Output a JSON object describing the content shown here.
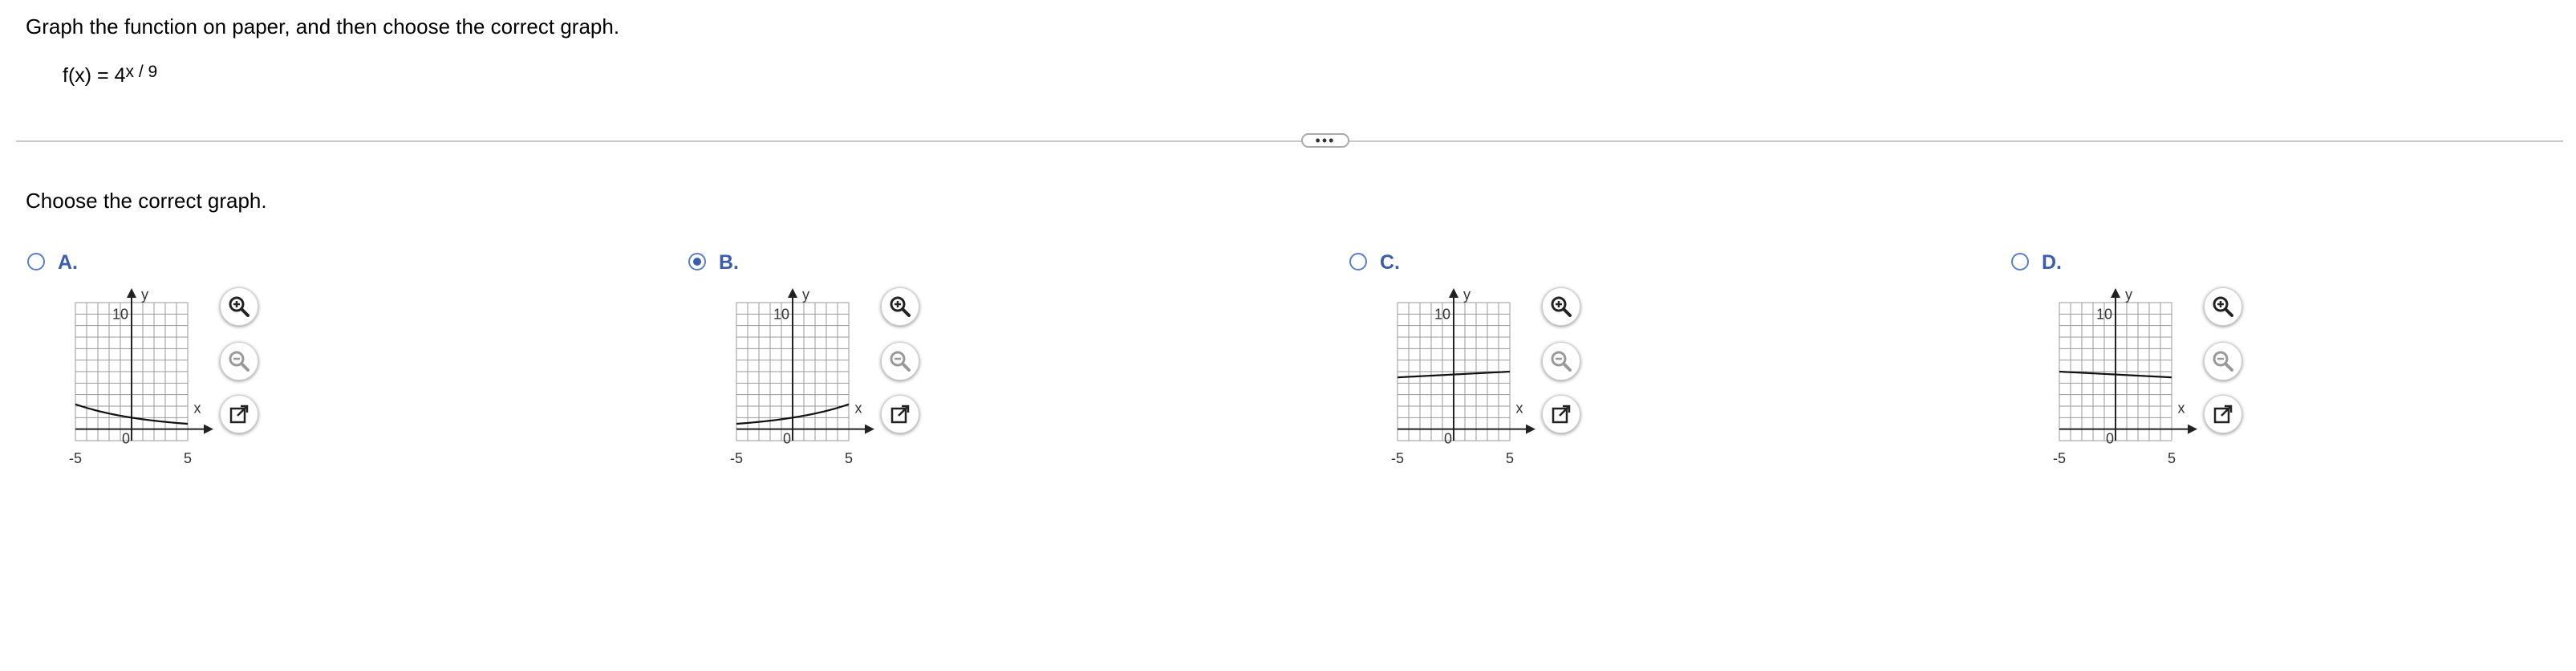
{
  "question": {
    "instruction": "Graph the function on paper, and then choose the correct graph.",
    "function_lhs": "f(x) = 4",
    "function_exponent": "x / 9"
  },
  "expand_label": "•••",
  "prompt": "Choose the correct graph.",
  "choices": [
    {
      "label": "A.",
      "selected": false,
      "curve": "4^(-x/9)"
    },
    {
      "label": "B.",
      "selected": true,
      "curve": "4^(x/9)"
    },
    {
      "label": "C.",
      "selected": false,
      "curve": "near-horizontal line, slightly increasing, y≈4.5–5"
    },
    {
      "label": "D.",
      "selected": false,
      "curve": "near-horizontal line, slightly decreasing, y≈5–4.5"
    }
  ],
  "graph_labels": {
    "x_axis": "x",
    "y_axis": "y",
    "y_tick": "10",
    "origin": "0",
    "x_min": "-5",
    "x_max": "5"
  },
  "chart_data": {
    "type": "line",
    "x_range": [
      -5,
      5
    ],
    "y_range": [
      -1,
      11
    ],
    "grid": true
  },
  "icons": {
    "zoom_in": "zoom-in-icon",
    "zoom_out": "zoom-out-icon",
    "popout": "popout-icon"
  },
  "colors": {
    "accent": "#3b5dac",
    "grid": "#9a9a9a",
    "divider": "#c6c6c6"
  }
}
